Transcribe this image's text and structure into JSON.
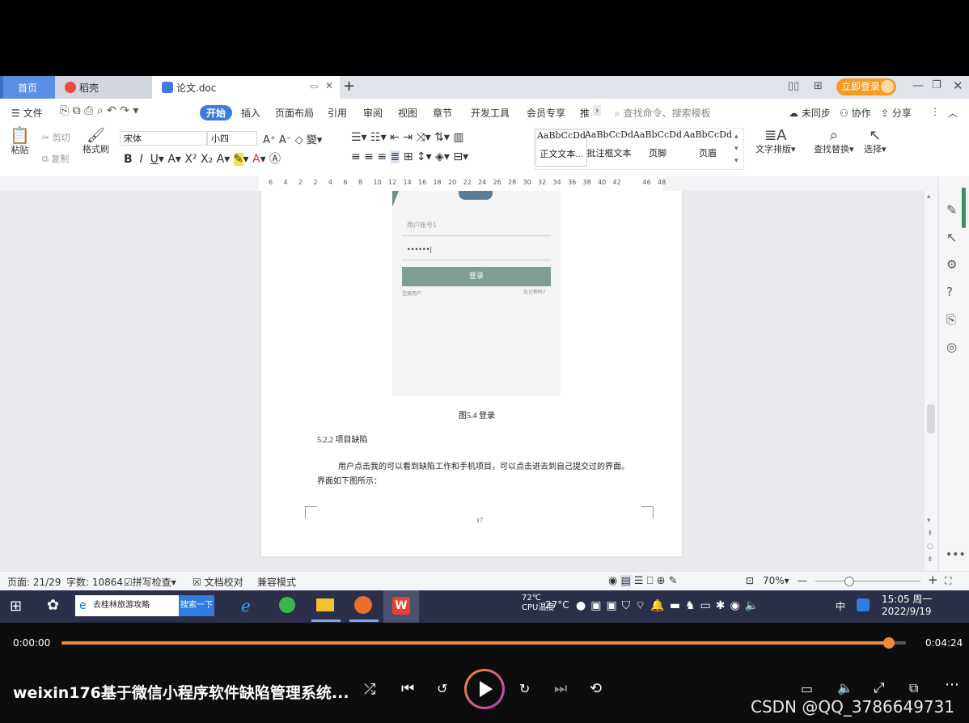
{
  "titlebar": {
    "tabs": [
      "首页",
      "稻壳",
      "论文.doc"
    ],
    "login_button": "立即登录"
  },
  "menu": {
    "file": "文件",
    "tabs": [
      "开始",
      "插入",
      "页面布局",
      "引用",
      "审阅",
      "视图",
      "章节",
      "开发工具",
      "会员专享",
      "推"
    ],
    "search_placeholder": "查找命令、搜索模板",
    "sync": "未同步",
    "collab": "协作",
    "share": "分享"
  },
  "ribbon": {
    "paste": "粘贴",
    "cut": "剪切",
    "copy": "复制",
    "format_painter": "格式刷",
    "font": "宋体",
    "size": "小四",
    "styles": [
      {
        "preview": "AaBbCcDd",
        "name": "正文文本..."
      },
      {
        "preview": "AaBbCcDd",
        "name": "批注框文本"
      },
      {
        "preview": "AaBbCcDd",
        "name": "页脚"
      },
      {
        "preview": "AaBbCcDd",
        "name": "页眉"
      }
    ],
    "text_layout": "文字排版",
    "find_replace": "查找替换",
    "select": "选择"
  },
  "ruler": {
    "ticks": [
      "6",
      "4",
      "2",
      "2",
      "4",
      "6",
      "8",
      "10",
      "12",
      "14",
      "16",
      "18",
      "20",
      "22",
      "24",
      "26",
      "28",
      "30",
      "32",
      "34",
      "36",
      "38",
      "40",
      "42",
      "46",
      "48"
    ]
  },
  "document": {
    "screenshot": {
      "account_placeholder": "用户账号1",
      "password_value": "••••••|",
      "login_button": "登录",
      "register_link": "注册用户",
      "forgot_link": "忘记密码?"
    },
    "figure_caption": "图5.4  登录",
    "section_heading": "5.2.2  项目缺陷",
    "paragraph_line1": "用户点击我的可以看到缺陷工作和手机项目，可以点击进去到自己提交过的界面。",
    "paragraph_line2": "界面如下图所示：",
    "page_number": "17"
  },
  "statusbar": {
    "page": "页面: 21/29",
    "words": "字数: 10864",
    "spellcheck": "拼写检查",
    "proof": "文档校对",
    "compat": "兼容模式",
    "zoom": "70%"
  },
  "taskbar": {
    "search_text": "去桂林旅游攻略",
    "search_button": "搜索一下",
    "weather_temp": "72℃",
    "weather_label": "CPU温度",
    "temp2": "27°C",
    "ime": "中",
    "time": "15:05 周一",
    "date": "2022/9/19"
  },
  "player": {
    "current_time": "0:00:00",
    "total_time": "0:04:24",
    "progress": 0.98,
    "title": "weixin176基于微信小程序软件缺陷管理系统...",
    "watermark": "CSDN @QQ_3786649731",
    "accent": "#f08a3c"
  }
}
